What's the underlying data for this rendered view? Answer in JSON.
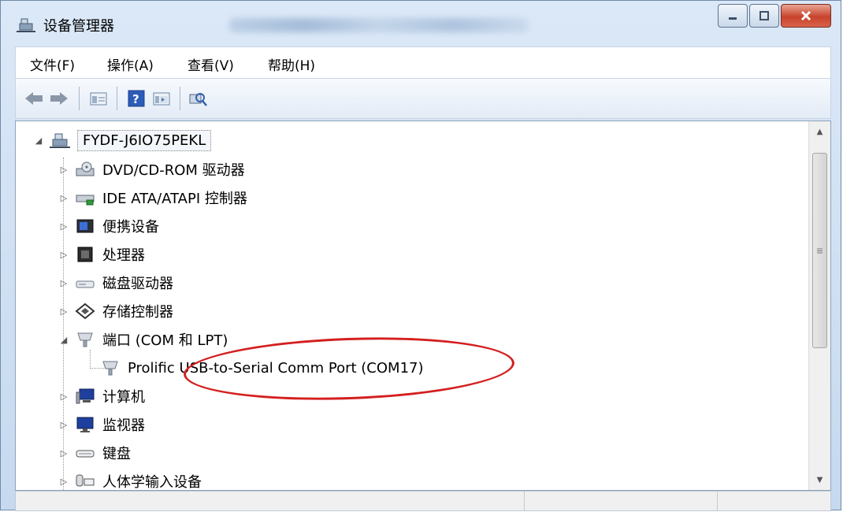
{
  "window": {
    "title": "设备管理器"
  },
  "menu": [
    {
      "label": "文件(F)"
    },
    {
      "label": "操作(A)"
    },
    {
      "label": "查看(V)"
    },
    {
      "label": "帮助(H)"
    }
  ],
  "toolbar": {
    "buttons": [
      "back-arrow-icon",
      "forward-arrow-icon",
      "properties-icon",
      "help-icon",
      "console-view-icon",
      "scan-hardware-icon"
    ]
  },
  "tree": {
    "root": {
      "label": "FYDF-J6IO75PEKL",
      "expander": "◢"
    },
    "nodes": [
      {
        "label": "DVD/CD-ROM 驱动器",
        "expander": "▷"
      },
      {
        "label": "IDE ATA/ATAPI 控制器",
        "expander": "▷"
      },
      {
        "label": "便携设备",
        "expander": "▷"
      },
      {
        "label": "处理器",
        "expander": "▷"
      },
      {
        "label": "磁盘驱动器",
        "expander": "▷"
      },
      {
        "label": "存储控制器",
        "expander": "▷"
      },
      {
        "label": "端口 (COM 和 LPT)",
        "expander": "◢"
      },
      {
        "label": "Prolific USB-to-Serial Comm Port (COM17)",
        "expander": ""
      },
      {
        "label": "计算机",
        "expander": "▷"
      },
      {
        "label": "监视器",
        "expander": "▷"
      },
      {
        "label": "键盘",
        "expander": "▷"
      },
      {
        "label": "人体学输入设备",
        "expander": "▷"
      }
    ]
  },
  "colors": {
    "annotation": "#d41f1f",
    "accent": "#1f5bbf"
  }
}
